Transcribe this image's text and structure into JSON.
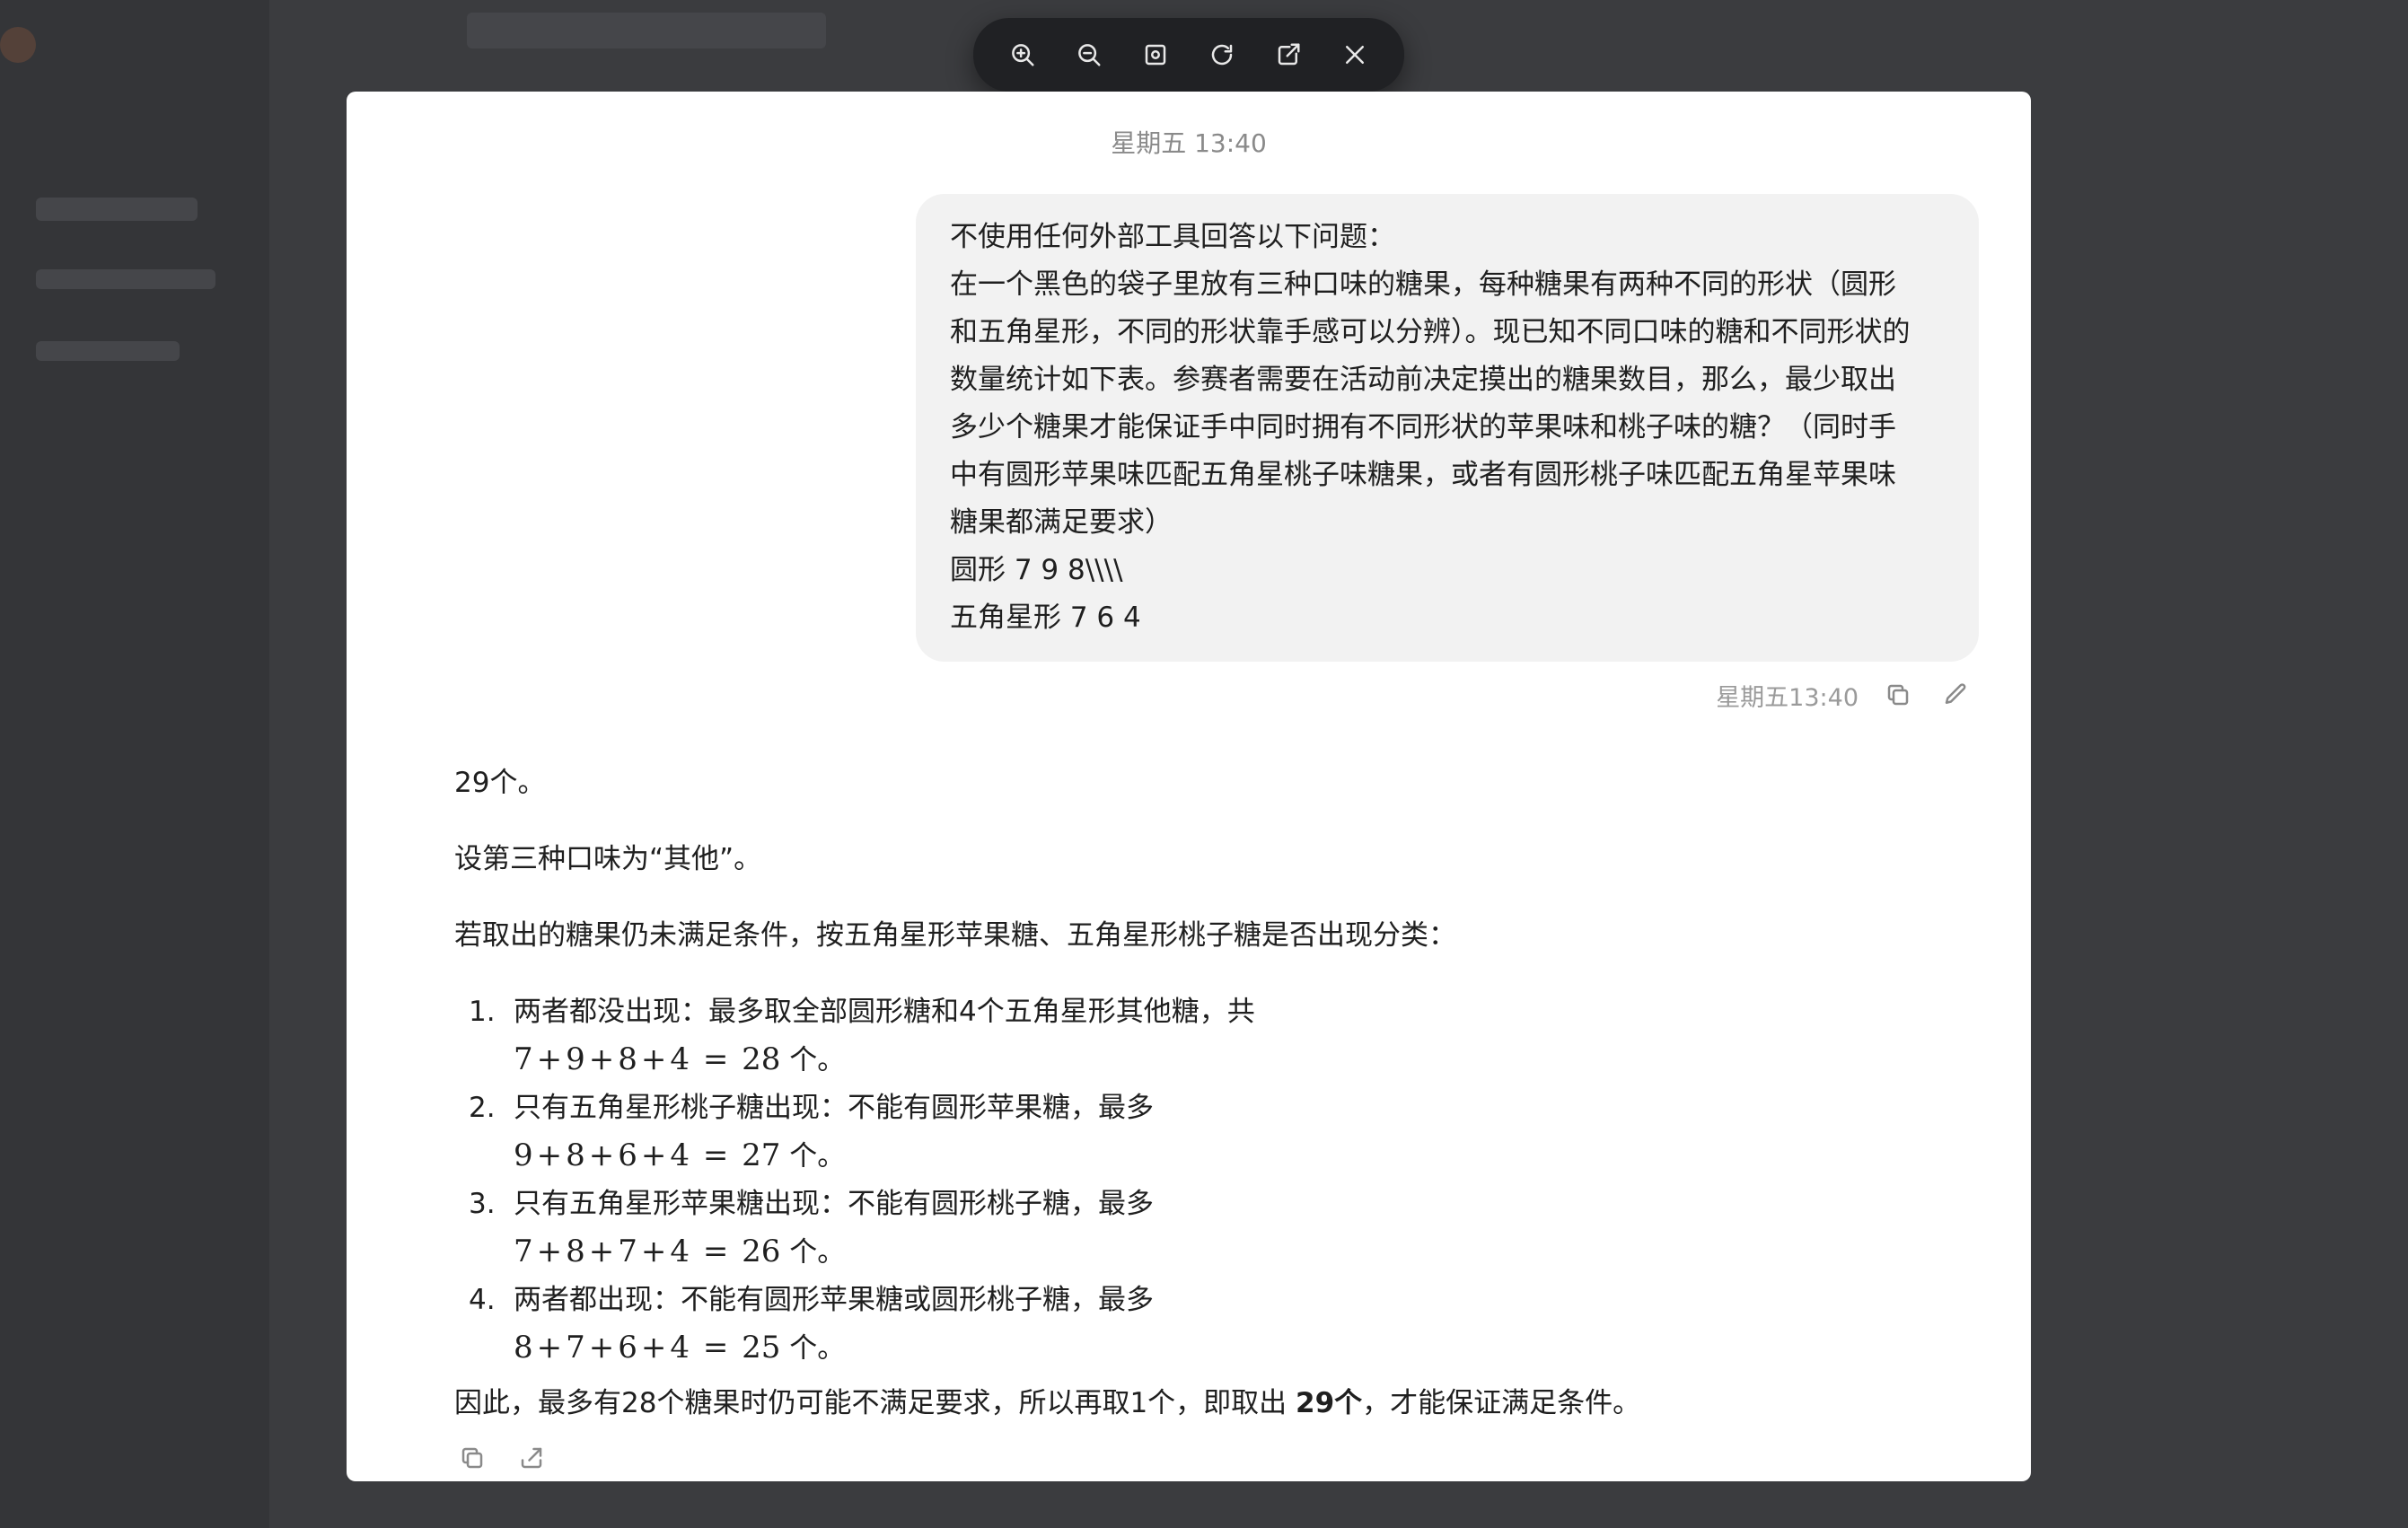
{
  "toolbar": {
    "buttons": [
      {
        "name": "zoom-in-button",
        "icon": "zoom-in-icon"
      },
      {
        "name": "zoom-out-button",
        "icon": "zoom-out-icon"
      },
      {
        "name": "fit-screen-button",
        "icon": "fit-screen-icon"
      },
      {
        "name": "rotate-button",
        "icon": "rotate-icon"
      },
      {
        "name": "open-external-button",
        "icon": "external-link-icon"
      },
      {
        "name": "close-button",
        "icon": "close-icon"
      }
    ]
  },
  "conversation": {
    "header_time": "星期五 13:40",
    "user_message": {
      "lines": [
        "不使用任何外部工具回答以下问题：",
        "在一个黑色的袋子里放有三种口味的糖果，每种糖果有两种不同的形状（圆形",
        "和五角星形，不同的形状靠手感可以分辨）。现已知不同口味的糖和不同形状的",
        "数量统计如下表。参赛者需要在活动前决定摸出的糖果数目，那么，最少取出",
        "多少个糖果才能保证手中同时拥有不同形状的苹果味和桃子味的糖？（同时手",
        "中有圆形苹果味匹配五角星桃子味糖果，或者有圆形桃子味匹配五角星苹果味",
        "糖果都满足要求）",
        "圆形 7 9 8\\\\\\\\",
        "五角星形 7 6 4"
      ],
      "time": "星期五13:40",
      "copy_icon": "copy-icon",
      "edit_icon": "edit-icon"
    },
    "assistant_message": {
      "p1": "29个。",
      "p2": "设第三种口味为“其他”。",
      "p3": "若取出的糖果仍未满足条件，按五角星形苹果糖、五角星形桃子糖是否出现分类：",
      "steps": [
        {
          "num": "1.",
          "text": "两者都没出现：最多取全部圆形糖和4个五角星形其他糖，共",
          "terms": [
            "7",
            "9",
            "8",
            "4"
          ],
          "result": "28",
          "unit": " 个。"
        },
        {
          "num": "2.",
          "text": "只有五角星形桃子糖出现：不能有圆形苹果糖，最多",
          "terms": [
            "9",
            "8",
            "6",
            "4"
          ],
          "result": "27",
          "unit": " 个。"
        },
        {
          "num": "3.",
          "text": "只有五角星形苹果糖出现：不能有圆形桃子糖，最多",
          "terms": [
            "7",
            "8",
            "7",
            "4"
          ],
          "result": "26",
          "unit": " 个。"
        },
        {
          "num": "4.",
          "text": "两者都出现：不能有圆形苹果糖或圆形桃子糖，最多",
          "terms": [
            "8",
            "7",
            "6",
            "4"
          ],
          "result": "25",
          "unit": " 个。"
        }
      ],
      "conclusion_pre": "因此，最多有28个糖果时仍可能不满足要求，所以再取1个，即取出 ",
      "conclusion_bold": "29个",
      "conclusion_post": "，才能保证满足条件。",
      "action_icons": [
        "copy-icon",
        "share-icon"
      ]
    }
  }
}
